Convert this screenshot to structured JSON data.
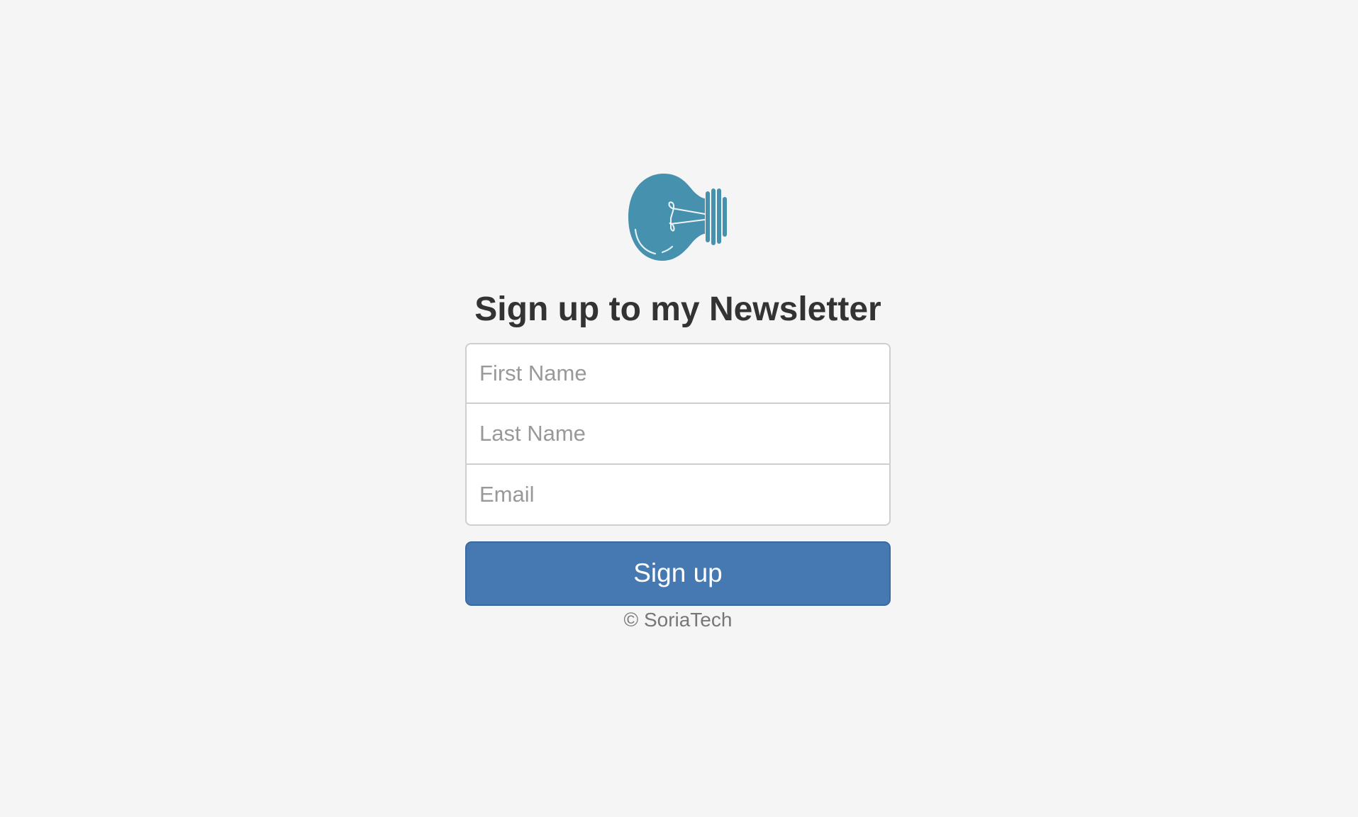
{
  "colors": {
    "background": "#f5f5f6",
    "logo": "#4591ae",
    "button": "#4679b1",
    "heading": "#333333"
  },
  "logo": {
    "icon": "lightbulb-icon"
  },
  "form": {
    "heading": "Sign up to my Newsletter",
    "fields": {
      "first_name": {
        "placeholder": "First Name",
        "value": ""
      },
      "last_name": {
        "placeholder": "Last Name",
        "value": ""
      },
      "email": {
        "placeholder": "Email",
        "value": ""
      }
    },
    "submit_label": "Sign up",
    "footer": "© SoriaTech"
  }
}
